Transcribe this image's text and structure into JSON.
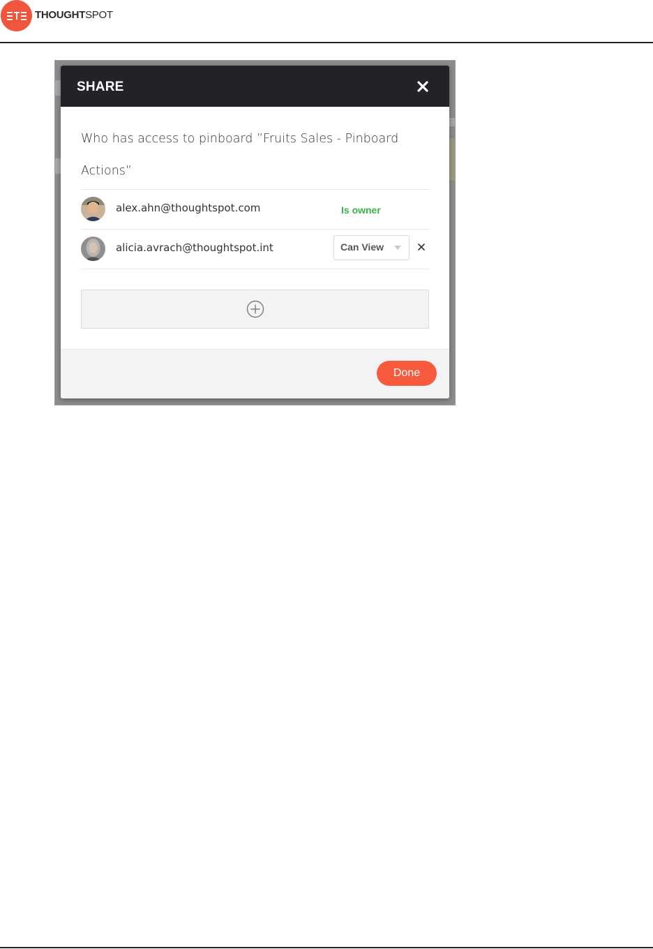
{
  "brand": {
    "logo_mark_text": "STS",
    "name_bold": "THOUGHT",
    "name_regular": "SPOT",
    "accent_color": "#f2553d"
  },
  "dialog": {
    "title": "SHARE",
    "question_line1": "Who has access to pinboard ”Fruits Sales - Pinboard",
    "question_line2": "Actions”",
    "users": [
      {
        "email": "alex.ahn@thoughtspot.com",
        "role": "Is owner",
        "role_color": "#37b34a"
      },
      {
        "email": "alicia.avrach@thoughtspot.int",
        "permission": "Can View"
      }
    ],
    "add_icon": "plus-circle-icon",
    "done_label": "Done",
    "done_color": "#f65b3d",
    "header_color": "#222326"
  }
}
